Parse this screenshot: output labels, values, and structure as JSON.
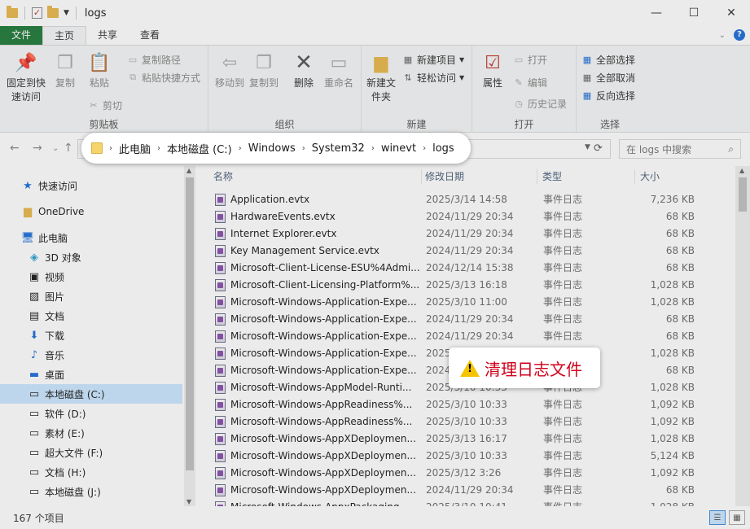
{
  "window": {
    "title": "logs",
    "minimize_icon": "minimize-icon",
    "maximize_icon": "maximize-icon",
    "close_icon": "close-icon"
  },
  "tabs": [
    "文件",
    "主页",
    "共享",
    "查看"
  ],
  "ribbon": {
    "clipboard": {
      "label": "剪贴板",
      "pin": "固定到快速访问",
      "copy": "复制",
      "paste": "粘贴",
      "copy_path": "复制路径",
      "paste_shortcut": "粘贴快捷方式",
      "cut": "剪切"
    },
    "organize": {
      "label": "组织",
      "move_to": "移动到",
      "copy_to": "复制到",
      "delete": "删除",
      "rename": "重命名"
    },
    "new": {
      "label": "新建",
      "new_folder": "新建文件夹",
      "new_item": "新建项目",
      "easy_access": "轻松访问"
    },
    "open": {
      "label": "打开",
      "properties": "属性",
      "open": "打开",
      "edit": "编辑",
      "history": "历史记录"
    },
    "select": {
      "label": "选择",
      "select_all": "全部选择",
      "select_none": "全部取消",
      "invert": "反向选择"
    }
  },
  "address": {
    "breadcrumb": [
      "此电脑",
      "本地磁盘 (C:)",
      "Windows",
      "System32",
      "winevt",
      "logs"
    ],
    "search_placeholder": "在 logs 中搜索"
  },
  "navpane": {
    "items": [
      {
        "label": "快速访问",
        "icon": "star-icon"
      },
      {
        "label": "OneDrive",
        "icon": "folder-icon"
      },
      {
        "label": "此电脑",
        "icon": "computer-icon"
      },
      {
        "label": "3D 对象",
        "icon": "cube-icon"
      },
      {
        "label": "视频",
        "icon": "video-icon"
      },
      {
        "label": "图片",
        "icon": "picture-icon"
      },
      {
        "label": "文档",
        "icon": "document-icon"
      },
      {
        "label": "下载",
        "icon": "download-icon"
      },
      {
        "label": "音乐",
        "icon": "music-icon"
      },
      {
        "label": "桌面",
        "icon": "desktop-icon"
      },
      {
        "label": "本地磁盘 (C:)",
        "icon": "drive-icon"
      },
      {
        "label": "软件 (D:)",
        "icon": "drive-icon"
      },
      {
        "label": "素材 (E:)",
        "icon": "drive-icon"
      },
      {
        "label": "超大文件 (F:)",
        "icon": "drive-icon"
      },
      {
        "label": "文档 (H:)",
        "icon": "drive-icon"
      },
      {
        "label": "本地磁盘 (J:)",
        "icon": "drive-icon"
      }
    ]
  },
  "filelist": {
    "columns": [
      "名称",
      "修改日期",
      "类型",
      "大小"
    ],
    "rows": [
      {
        "name": "Application.evtx",
        "date": "2025/3/14 14:58",
        "type": "事件日志",
        "size": "7,236 KB"
      },
      {
        "name": "HardwareEvents.evtx",
        "date": "2024/11/29 20:34",
        "type": "事件日志",
        "size": "68 KB"
      },
      {
        "name": "Internet Explorer.evtx",
        "date": "2024/11/29 20:34",
        "type": "事件日志",
        "size": "68 KB"
      },
      {
        "name": "Key Management Service.evtx",
        "date": "2024/11/29 20:34",
        "type": "事件日志",
        "size": "68 KB"
      },
      {
        "name": "Microsoft-Client-License-ESU%4Admi...",
        "date": "2024/12/14 15:38",
        "type": "事件日志",
        "size": "68 KB"
      },
      {
        "name": "Microsoft-Client-Licensing-Platform%...",
        "date": "2025/3/13 16:18",
        "type": "事件日志",
        "size": "1,028 KB"
      },
      {
        "name": "Microsoft-Windows-Application-Expe...",
        "date": "2025/3/10 11:00",
        "type": "事件日志",
        "size": "1,028 KB"
      },
      {
        "name": "Microsoft-Windows-Application-Expe...",
        "date": "2024/11/29 20:34",
        "type": "事件日志",
        "size": "68 KB"
      },
      {
        "name": "Microsoft-Windows-Application-Expe...",
        "date": "2024/11/29 20:34",
        "type": "事件日志",
        "size": "68 KB"
      },
      {
        "name": "Microsoft-Windows-Application-Expe...",
        "date": "2025",
        "type": "事件日志",
        "size": "1,028 KB"
      },
      {
        "name": "Microsoft-Windows-Application-Expe...",
        "date": "2024",
        "type": "事件日志",
        "size": "68 KB"
      },
      {
        "name": "Microsoft-Windows-AppModel-Runti...",
        "date": "2025/3/10 10:33",
        "type": "事件日志",
        "size": "1,028 KB"
      },
      {
        "name": "Microsoft-Windows-AppReadiness%...",
        "date": "2025/3/10 10:33",
        "type": "事件日志",
        "size": "1,092 KB"
      },
      {
        "name": "Microsoft-Windows-AppReadiness%...",
        "date": "2025/3/10 10:33",
        "type": "事件日志",
        "size": "1,092 KB"
      },
      {
        "name": "Microsoft-Windows-AppXDeploymen...",
        "date": "2025/3/13 16:17",
        "type": "事件日志",
        "size": "1,028 KB"
      },
      {
        "name": "Microsoft-Windows-AppXDeploymen...",
        "date": "2025/3/10 10:33",
        "type": "事件日志",
        "size": "5,124 KB"
      },
      {
        "name": "Microsoft-Windows-AppXDeploymen...",
        "date": "2025/3/12 3:26",
        "type": "事件日志",
        "size": "1,092 KB"
      },
      {
        "name": "Microsoft-Windows-AppXDeploymen...",
        "date": "2024/11/29 20:34",
        "type": "事件日志",
        "size": "68 KB"
      },
      {
        "name": "Microsoft-Windows-AppxPackaging...",
        "date": "2025/3/10 10:41",
        "type": "事件日志",
        "size": "1,028 KB"
      }
    ]
  },
  "callout": {
    "warning_text": "清理日志文件"
  },
  "status": {
    "item_count": "167 个项目"
  },
  "colors": {
    "file_tab": "#1f7a3a",
    "warning": "#d0021b",
    "selection": "#cce8ff"
  }
}
